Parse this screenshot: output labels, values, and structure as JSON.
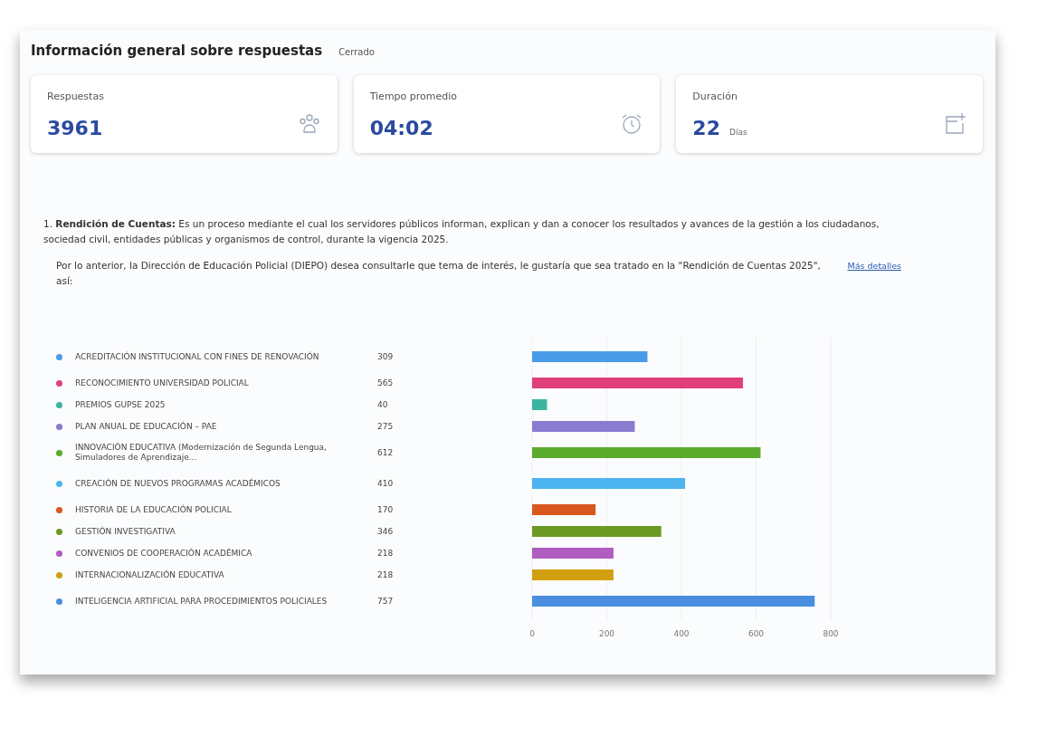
{
  "header": {
    "title": "Información general sobre respuestas",
    "status": "Cerrado"
  },
  "stats": [
    {
      "kind": "people",
      "label": "Respuestas",
      "value": "3961"
    },
    {
      "kind": "clock",
      "label": "Tiempo promedio",
      "value": "04:02"
    },
    {
      "kind": "calendar",
      "label": "Duración",
      "value": "22",
      "unit": "Días"
    }
  ],
  "question": {
    "number": "1.",
    "title": "Rendición de Cuentas:",
    "text": "Es un proceso mediante el cual los servidores públicos informan, explican y dan a conocer los resultados y avances de la gestión a los ciudadanos, sociedad civil, entidades públicas y organismos de control, durante la vigencia 2025.",
    "prompt": "Por lo anterior, la Dirección de Educación Policial (DIEPO) desea consultarle que tema de interés, le gustaría que sea tratado en la \"Rendición de Cuentas 2025\", así:",
    "link": "Más detalles"
  },
  "options": [
    {
      "label": "ACREDITACIÓN INSTITUCIONAL CON FINES DE RENOVACIÓN",
      "count": "309",
      "color": "#4a9be8"
    },
    {
      "label": "RECONOCIMIENTO UNIVERSIDAD POLICIAL",
      "count": "565",
      "color": "#e0407a"
    },
    {
      "label": "PREMIOS GUPSE 2025",
      "count": "40",
      "color": "#3bb5a0"
    },
    {
      "label": "PLAN ANUAL DE EDUCACIÓN – PAE",
      "count": "275",
      "color": "#8a7bd0"
    },
    {
      "label": "INNOVACIÓN EDUCATIVA (Modernización de Segunda Lengua, Simuladores de Aprendizaje...",
      "count": "612",
      "color": "#5aab2e"
    },
    {
      "label": "CREACIÓN DE NUEVOS PROGRAMAS ACADÉMICOS",
      "count": "410",
      "color": "#4cb4ee"
    },
    {
      "label": "HISTORIA DE LA EDUCACIÓN POLICIAL",
      "count": "170",
      "color": "#d9561e"
    },
    {
      "label": "GESTIÓN INVESTIGATIVA",
      "count": "346",
      "color": "#6a9a22"
    },
    {
      "label": "CONVENIOS DE COOPERACIÓN ACADÉMICA",
      "count": "218",
      "color": "#b05cc0"
    },
    {
      "label": "INTERNACIONALIZACIÓN EDUCATIVA",
      "count": "218",
      "color": "#d0a010"
    },
    {
      "label": "INTELIGENCIA ARTIFICIAL PARA PROCEDIMIENTOS POLICIALES",
      "count": "757",
      "color": "#4a8ee0"
    }
  ],
  "chart_data": {
    "type": "bar",
    "orientation": "horizontal",
    "values": [
      309,
      565,
      40,
      275,
      612,
      410,
      170,
      346,
      218,
      218,
      757
    ],
    "xlim": [
      0,
      800
    ],
    "grid": true,
    "xticks": [
      0,
      200,
      400,
      600,
      800
    ]
  }
}
